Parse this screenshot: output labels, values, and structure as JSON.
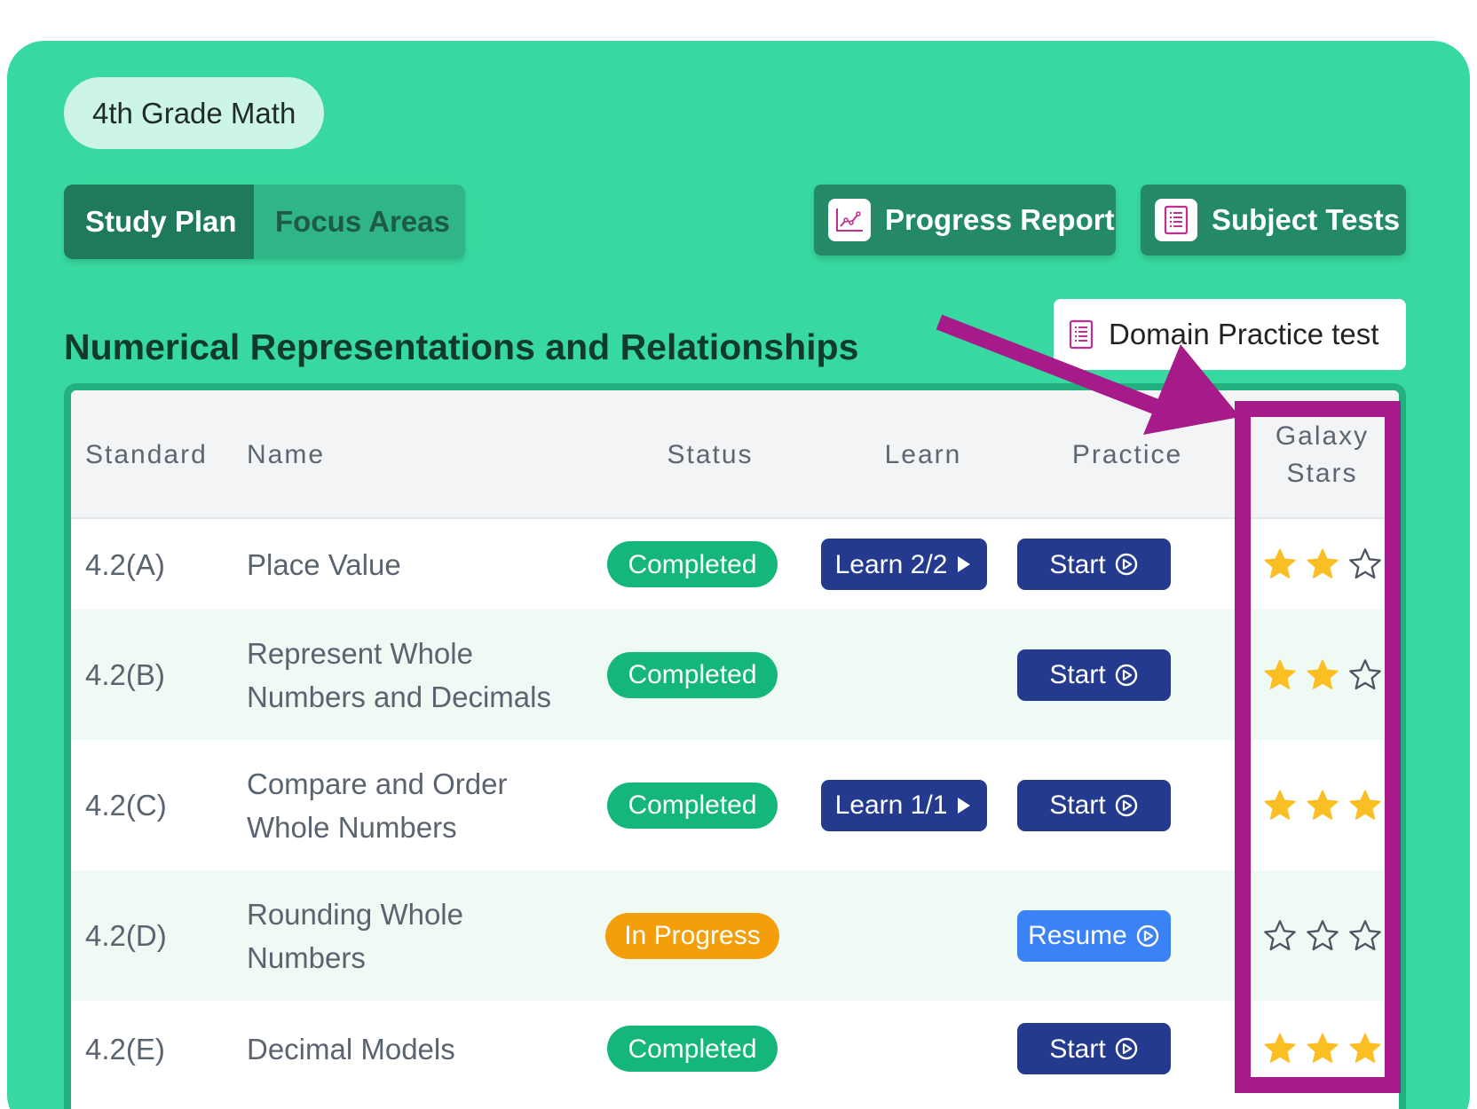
{
  "subject_pill": "4th Grade Math",
  "tabs": [
    {
      "label": "Study Plan",
      "active": true
    },
    {
      "label": "Focus Areas",
      "active": false
    }
  ],
  "actions": {
    "progress_report": "Progress Report",
    "subject_tests": "Subject Tests",
    "domain_practice": "Domain Practice test"
  },
  "section_title": "Numerical Representations and Relationships",
  "table": {
    "headers": {
      "standard": "Standard",
      "name": "Name",
      "status": "Status",
      "learn": "Learn",
      "practice": "Practice",
      "stars_line1": "Galaxy",
      "stars_line2": "Stars"
    },
    "rows": [
      {
        "standard": "4.2(A)",
        "name_l1": "Place Value",
        "name_l2": "",
        "status": "Completed",
        "learn": "Learn 2/2",
        "practice": "Start",
        "stars": 2
      },
      {
        "standard": "4.2(B)",
        "name_l1": "Represent Whole",
        "name_l2": "Numbers and Decimals",
        "status": "Completed",
        "learn": "",
        "practice": "Start",
        "stars": 2
      },
      {
        "standard": "4.2(C)",
        "name_l1": "Compare and Order",
        "name_l2": "Whole Numbers",
        "status": "Completed",
        "learn": "Learn 1/1",
        "practice": "Start",
        "stars": 3
      },
      {
        "standard": "4.2(D)",
        "name_l1": "Rounding Whole",
        "name_l2": "Numbers",
        "status": "In Progress",
        "learn": "",
        "practice": "Resume",
        "stars": 0
      },
      {
        "standard": "4.2(E)",
        "name_l1": "Decimal Models",
        "name_l2": "",
        "status": "Completed",
        "learn": "",
        "practice": "Start",
        "stars": 3
      }
    ]
  },
  "colors": {
    "panel": "#38d9a0",
    "star_filled": "#fbbf24",
    "annotation": "#a61a8a"
  }
}
